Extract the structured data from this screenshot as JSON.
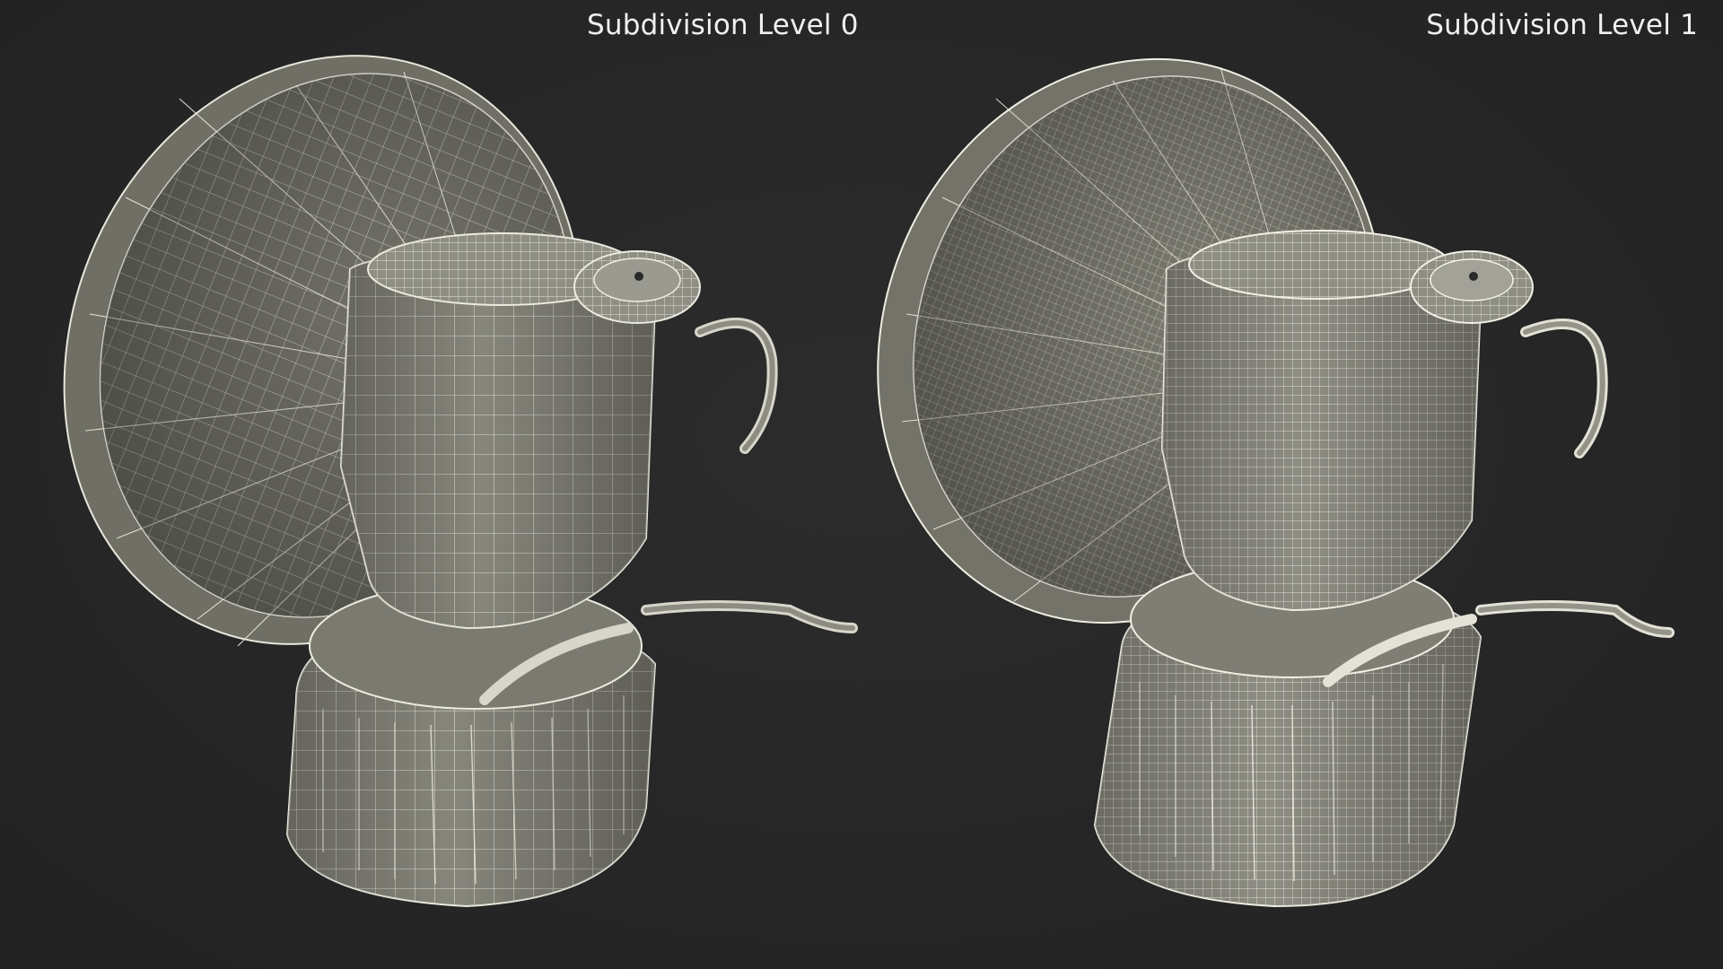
{
  "labels": {
    "left": "Subdivision Level 0",
    "right": "Subdivision Level 1"
  },
  "render": {
    "subject": "carbide-lamp-wireframe",
    "background_color": "#272727",
    "surface_color": "#8a8a80",
    "wire_color": "#f4f2e8",
    "label_color": "#f0f0f0"
  }
}
